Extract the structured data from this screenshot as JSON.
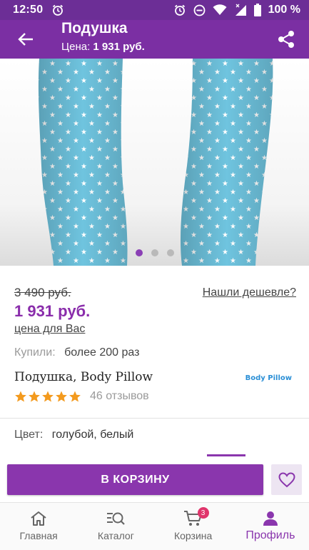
{
  "status_bar": {
    "time": "12:50",
    "battery": "100 %"
  },
  "app_bar": {
    "title": "Подушка",
    "price_label": "Цена:",
    "price_value": "1 931 руб."
  },
  "gallery": {
    "image_count": 3,
    "active_index": 0
  },
  "product": {
    "old_price": "3 490 руб.",
    "cheaper_link": "Нашли дешевле?",
    "new_price": "1 931 руб.",
    "price_for_you": "цена для Вас",
    "bought_label": "Купили:",
    "bought_value": "более 200 раз",
    "name": "Подушка, Body Pillow",
    "brand_logo_text": "Body Pillow",
    "rating_stars": 5,
    "reviews": "46 отзывов",
    "color_label": "Цвет:",
    "color_value": "голубой, белый"
  },
  "actions": {
    "cart_button": "В КОРЗИНУ"
  },
  "bottom_nav": {
    "items": [
      {
        "label": "Главная",
        "icon": "home-icon"
      },
      {
        "label": "Каталог",
        "icon": "catalog-search-icon"
      },
      {
        "label": "Корзина",
        "icon": "cart-icon",
        "badge": "3"
      },
      {
        "label": "Профиль",
        "icon": "profile-icon",
        "active": true
      }
    ]
  },
  "colors": {
    "status_bar": "#6c2e96",
    "app_bar": "#7b2fa3",
    "accent": "#8a36ad",
    "price": "#8a2dab",
    "star": "#f39a1e",
    "badge": "#e0356c",
    "pillow": "#6fc4df"
  }
}
